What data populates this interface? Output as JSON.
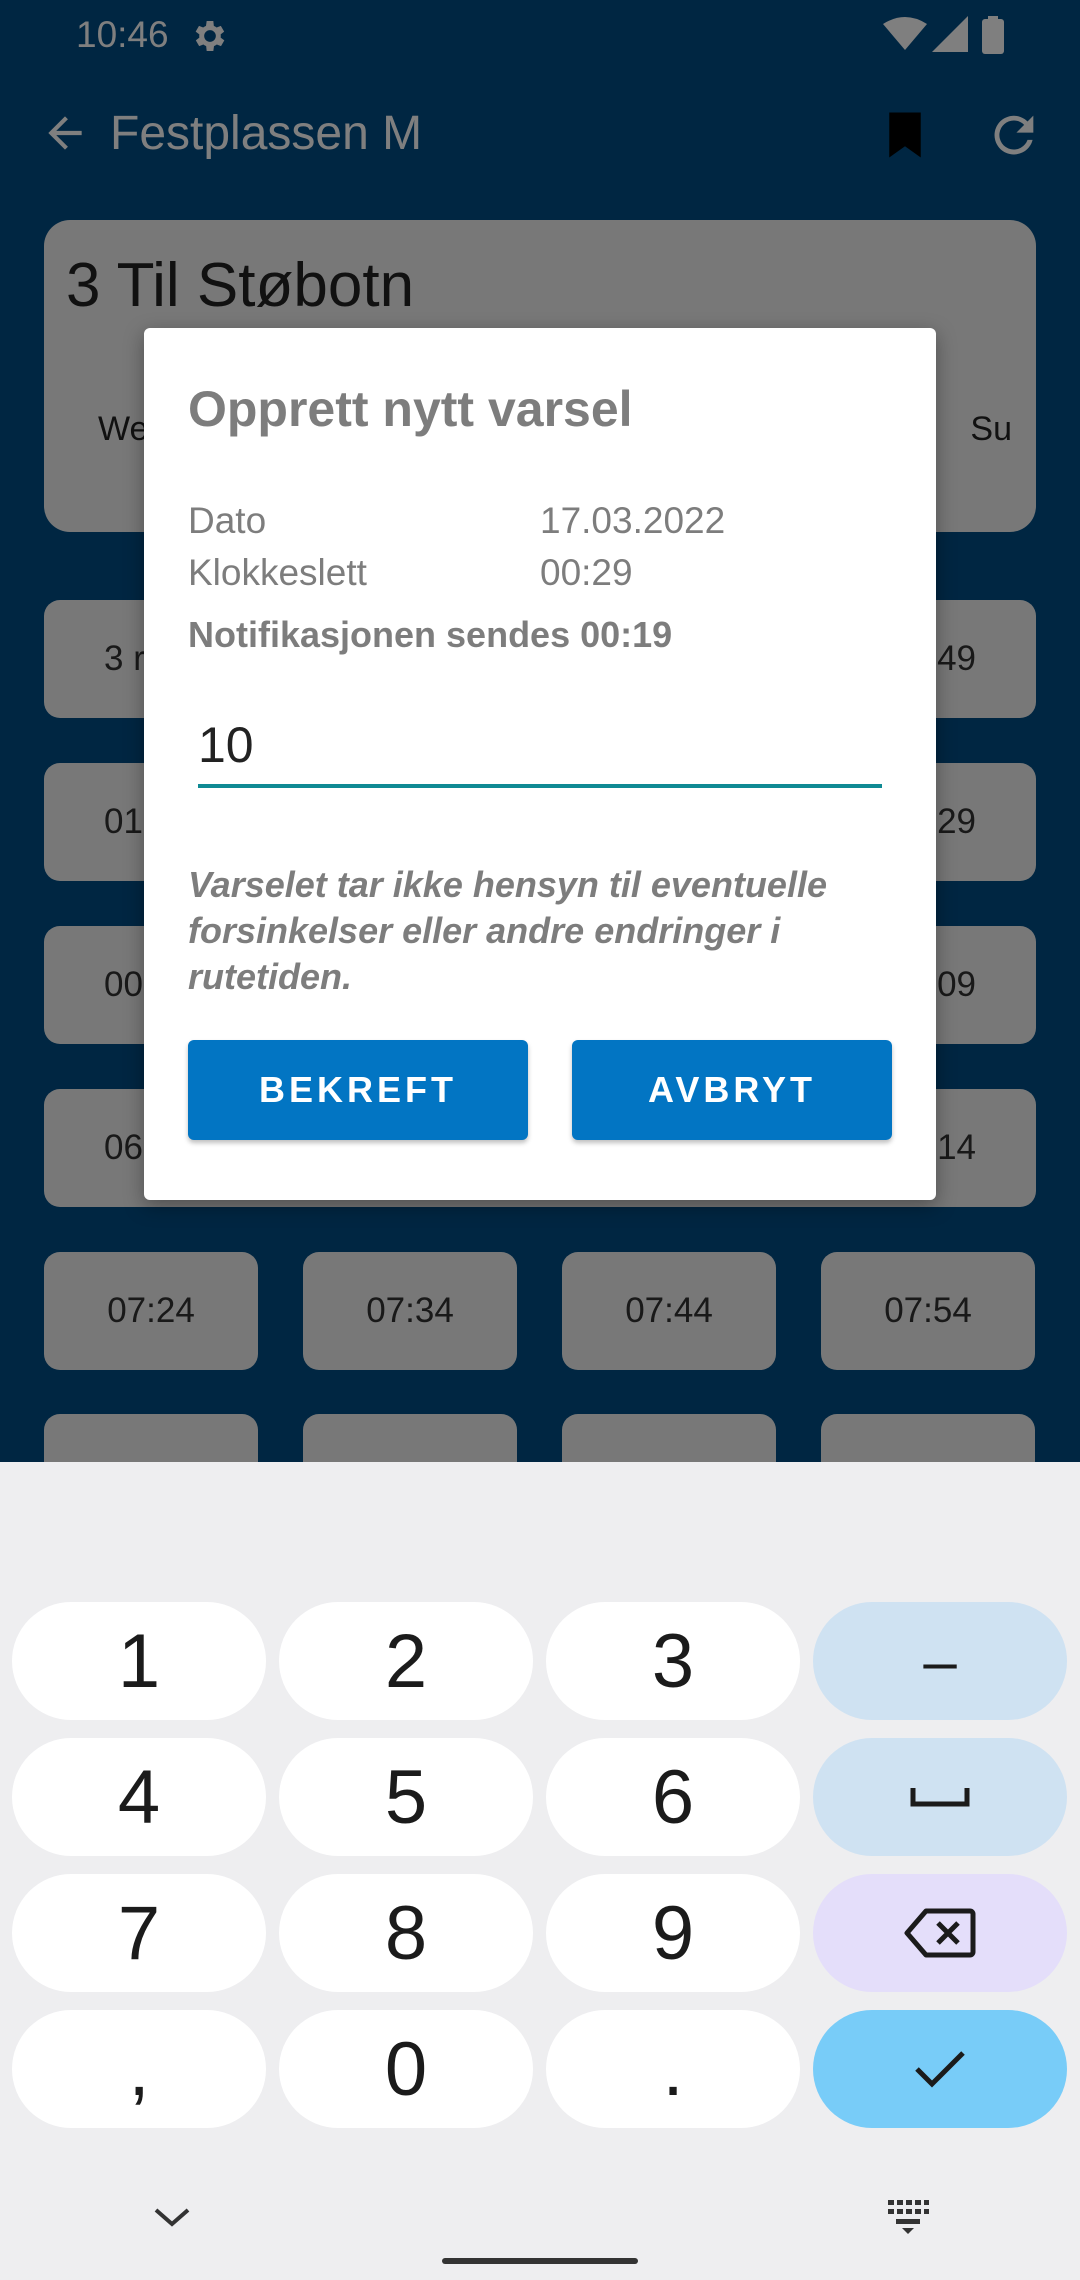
{
  "status": {
    "time": "10:46"
  },
  "toolbar": {
    "title": "Festplassen M"
  },
  "route": {
    "title": "3  Til Støbotn",
    "left_label": "We",
    "right_label": "Su"
  },
  "chips": {
    "row1": {
      "left": "3 r",
      "right": "49"
    },
    "row2": {
      "left": "01",
      "right": "29"
    },
    "row3": {
      "left": "00",
      "right": "09"
    },
    "row4": {
      "left": "06",
      "right": "14"
    },
    "row5": [
      "07:24",
      "07:34",
      "07:44",
      "07:54"
    ]
  },
  "dialog": {
    "title": "Opprett nytt varsel",
    "date_label": "Dato",
    "date_value": "17.03.2022",
    "time_label": "Klokkeslett",
    "time_value": "00:29",
    "notification": "Notifikasjonen sendes 00:19",
    "minutes_value": "10",
    "warning": "Varselet tar ikke hensyn til eventuelle forsinkelser eller andre endringer i rutetiden.",
    "confirm_label": "BEKREFT",
    "cancel_label": "AVBRYT"
  },
  "keyboard": {
    "keys": [
      "1",
      "2",
      "3",
      "–",
      "4",
      "5",
      "6",
      "7",
      "8",
      "9",
      ",",
      "0",
      "."
    ]
  },
  "colors": {
    "app_bar": "#014d84",
    "primary_button": "#0275c3",
    "input_underline": "#0f8a94",
    "key_done": "#78ccf8"
  }
}
